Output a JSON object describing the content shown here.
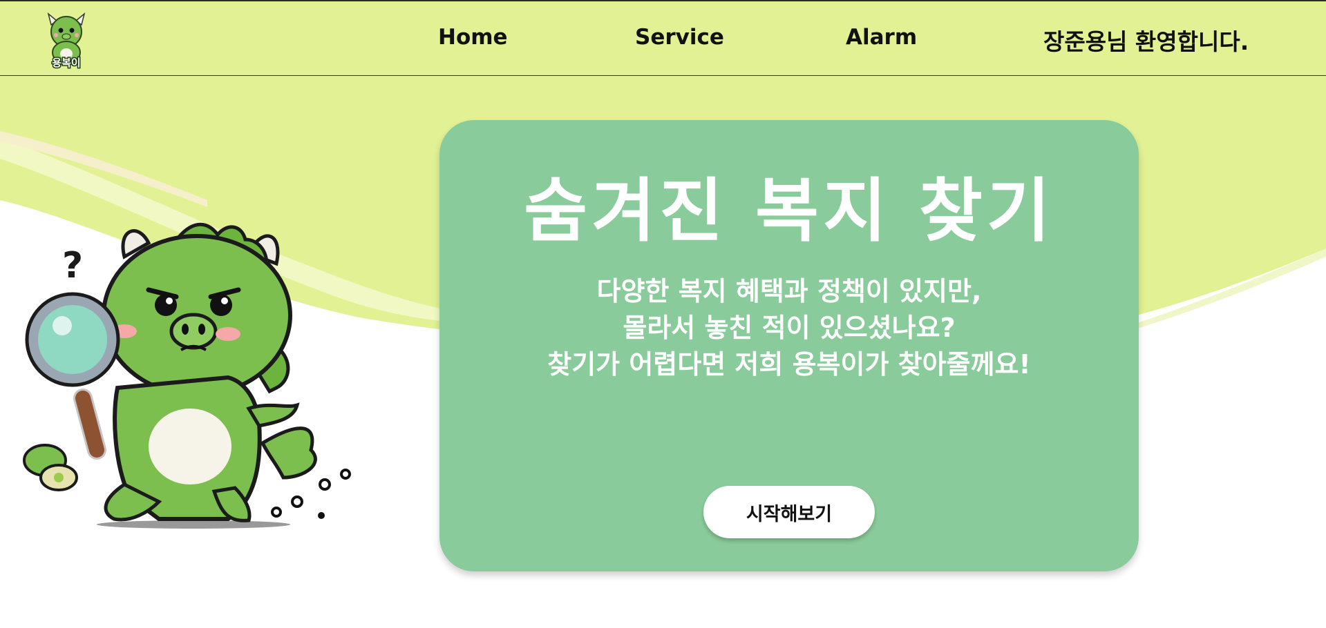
{
  "nav": {
    "logo_text": "용복이",
    "links": [
      "Home",
      "Service",
      "Alarm"
    ],
    "welcome": "장준용님 환영합니다."
  },
  "hero": {
    "title": "숨겨진 복지 찾기",
    "subtitle_lines": [
      "다양한 복지 혜택과 정책이 있지만,",
      "몰라서 놓친 적이 있으셨나요?",
      "찾기가 어렵다면 저희 용복이가 찾아줄께요!"
    ],
    "button_label": "시작해보기"
  },
  "colors": {
    "navbar_bg": "#e2f194",
    "card_bg": "#89cb9a",
    "mascot_green": "#7cbf4f",
    "text_white": "#ffffff"
  },
  "icons": {
    "logo": "dragon-mascot-logo",
    "mascot": "dragon-mascot-magnifier-illustration"
  }
}
